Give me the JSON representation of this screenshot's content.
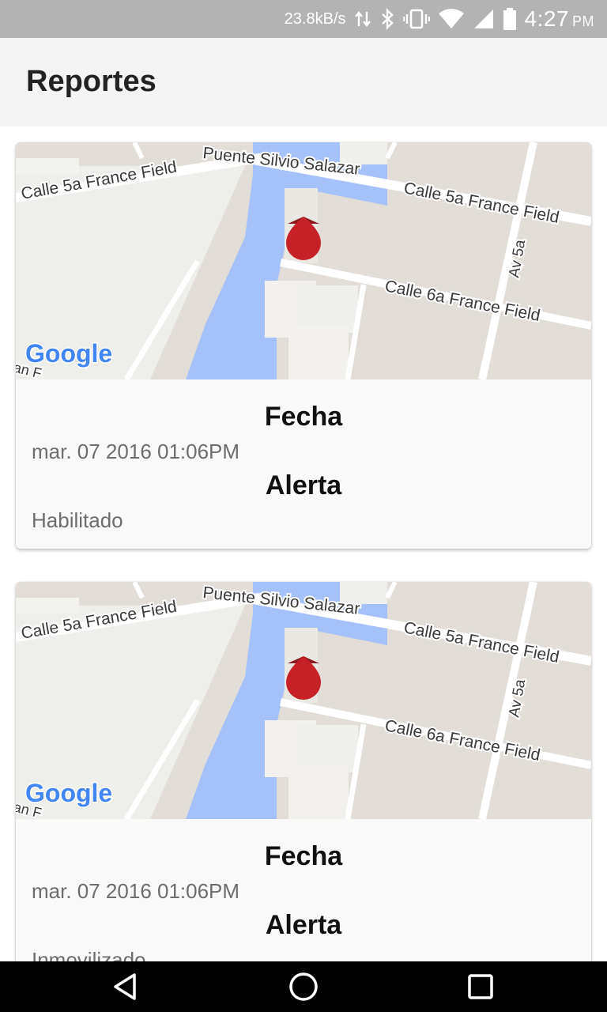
{
  "status_bar": {
    "net_speed": "23.8kB/s",
    "time": "4:27",
    "ampm": "PM",
    "icons": [
      "data-transfer-icon",
      "bluetooth-icon",
      "vibrate-icon",
      "wifi-icon",
      "cell-signal-icon",
      "battery-icon"
    ]
  },
  "app_bar": {
    "title": "Reportes"
  },
  "map": {
    "streets": [
      "Calle 5a France Field",
      "Puente Silvio Salazar",
      "Calle 5a France Field",
      "Av 5a",
      "Calle 6a France Field"
    ],
    "logo": "Google",
    "partial_label": "an F",
    "marker_color": "#c62127"
  },
  "reports": [
    {
      "fecha_label": "Fecha",
      "fecha": "mar. 07 2016 01:06PM",
      "alerta_label": "Alerta",
      "alerta": "Habilitado"
    },
    {
      "fecha_label": "Fecha",
      "fecha": "mar. 07 2016 01:06PM",
      "alerta_label": "Alerta",
      "alerta": "Inmovilizado"
    }
  ],
  "nav_bar": {
    "buttons": [
      "back-icon",
      "home-icon",
      "recents-icon"
    ]
  },
  "colors": {
    "status_bar": "#b3b3b3",
    "app_bar": "#f4f4f4",
    "water": "#a4c1f9",
    "land": "#e2ddd7",
    "park": "#eeeeea"
  }
}
